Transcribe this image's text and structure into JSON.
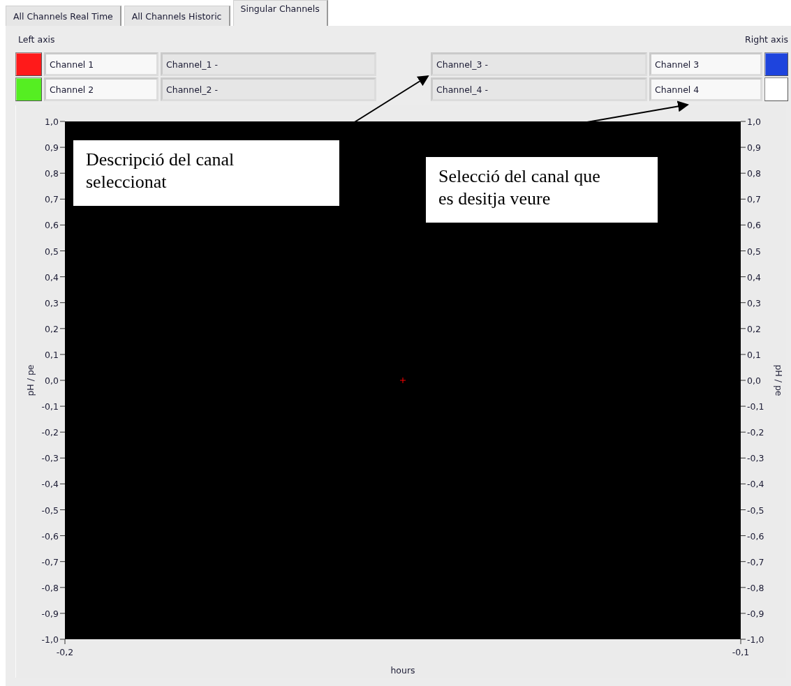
{
  "tabs": [
    {
      "label": "All Channels Real Time",
      "selected": false
    },
    {
      "label": "All Channels Historic",
      "selected": false
    },
    {
      "label": "Singular Channels",
      "selected": true
    }
  ],
  "left_axis": {
    "label": "Left axis",
    "channels": [
      {
        "name": "Channel 1",
        "description": "Channel_1 -",
        "color": "#ff1a1a"
      },
      {
        "name": "Channel 2",
        "description": "Channel_2 -",
        "color": "#55ee22"
      }
    ]
  },
  "right_axis": {
    "label": "Right axis",
    "channels": [
      {
        "name": "Channel 3",
        "description": "Channel_3 -",
        "color": "#1e44dd"
      },
      {
        "name": "Channel 4",
        "description": "Channel_4 -",
        "color": "#ffffff"
      }
    ]
  },
  "graph": {
    "chart_data": {
      "type": "scatter",
      "xlabel": "hours",
      "ylabel": "pH / pe",
      "y2label": "pH / pe",
      "xlim": [
        -0.2,
        -0.1
      ],
      "ylim": [
        -1,
        1
      ],
      "xticks": [
        {
          "value": -0.2,
          "label": "-0,2"
        },
        {
          "value": -0.1,
          "label": "-0,1"
        }
      ],
      "yticks": [
        {
          "value": 1,
          "label": "1,0"
        },
        {
          "value": 0.9,
          "label": "0,9"
        },
        {
          "value": 0.8,
          "label": "0,8"
        },
        {
          "value": 0.7,
          "label": "0,7"
        },
        {
          "value": 0.6,
          "label": "0,6"
        },
        {
          "value": 0.5,
          "label": "0,5"
        },
        {
          "value": 0.4,
          "label": "0,4"
        },
        {
          "value": 0.3,
          "label": "0,3"
        },
        {
          "value": 0.2,
          "label": "0,2"
        },
        {
          "value": 0.1,
          "label": "0,1"
        },
        {
          "value": 0,
          "label": "0,0"
        },
        {
          "value": -0.1,
          "label": "-0,1"
        },
        {
          "value": -0.2,
          "label": "-0,2"
        },
        {
          "value": -0.3,
          "label": "-0,3"
        },
        {
          "value": -0.4,
          "label": "-0,4"
        },
        {
          "value": -0.5,
          "label": "-0,5"
        },
        {
          "value": -0.6,
          "label": "-0,6"
        },
        {
          "value": -0.7,
          "label": "-0,7"
        },
        {
          "value": -0.8,
          "label": "-0,8"
        },
        {
          "value": -0.9,
          "label": "-0,9"
        },
        {
          "value": -1,
          "label": "-1,0"
        }
      ],
      "x": [
        -0.15
      ],
      "series": [
        {
          "color": "#ff0000",
          "values": [
            0
          ]
        }
      ]
    }
  },
  "annotations": [
    {
      "text": "Descripció del canal seleccionat"
    },
    {
      "text": "Selecció del canal que es desitja veure"
    }
  ]
}
